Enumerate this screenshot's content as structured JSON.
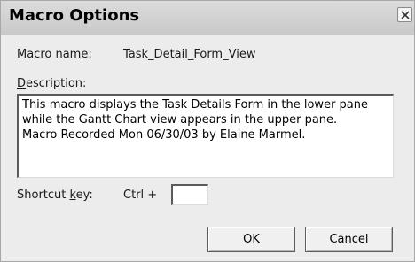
{
  "window": {
    "title": "Macro Options",
    "close_icon": "close-icon"
  },
  "macro_name": {
    "label": "Macro name:",
    "value": "Task_Detail_Form_View"
  },
  "description": {
    "label_underlined": "D",
    "label_rest": "escription:",
    "lines": [
      "This macro displays the Task Details Form in the lower pane",
      "while the Gantt Chart view appears in the upper pane.",
      "Macro Recorded Mon 06/30/03 by Elaine Marmel."
    ]
  },
  "shortcut": {
    "label_prefix": "Shortcut ",
    "label_underlined": "k",
    "label_rest": "ey:",
    "modifier": "Ctrl +",
    "value": ""
  },
  "buttons": {
    "ok": "OK",
    "cancel": "Cancel"
  }
}
